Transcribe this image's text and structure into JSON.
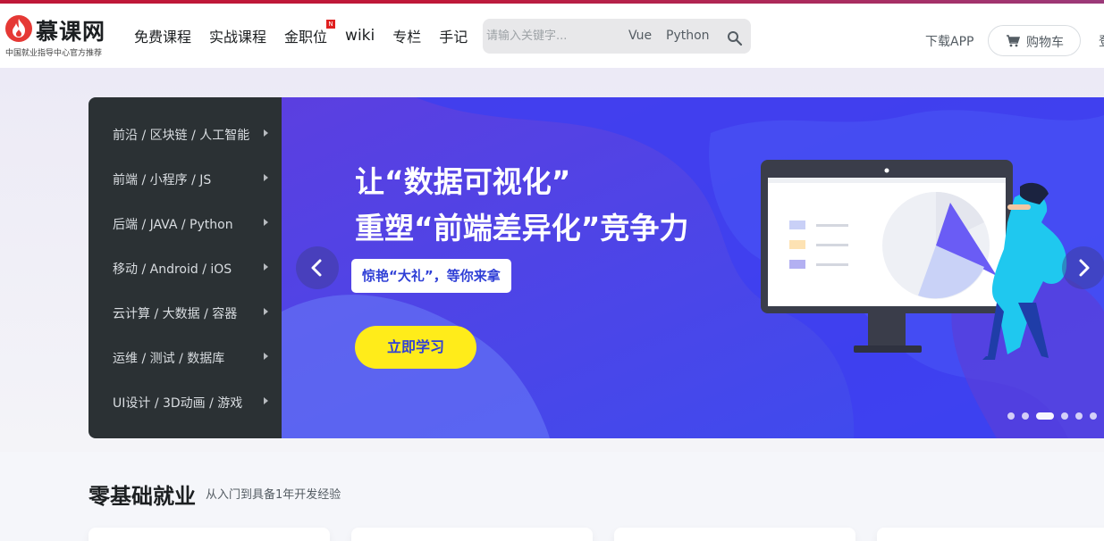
{
  "logo": {
    "name": "慕课网",
    "tagline": "中国就业指导中心官方推荐"
  },
  "nav": {
    "items": [
      {
        "label": "免费课程"
      },
      {
        "label": "实战课程"
      },
      {
        "label": "金职位",
        "badge": "N"
      },
      {
        "label": "wiki"
      },
      {
        "label": "专栏"
      },
      {
        "label": "手记"
      }
    ]
  },
  "search": {
    "placeholder": "请输入关键字...",
    "hot_keywords": [
      "Vue",
      "Python"
    ]
  },
  "header_right": {
    "download_label": "下载APP",
    "cart_label": "购物车",
    "edge_text": "登"
  },
  "category_menu": {
    "items": [
      "前沿 / 区块链 / 人工智能",
      "前端 / 小程序 / JS",
      "后端 / JAVA / Python",
      "移动 / Android / iOS",
      "云计算 / 大数据 / 容器",
      "运维 / 测试 / 数据库",
      "UI设计 / 3D动画 / 游戏"
    ]
  },
  "banner": {
    "headline_1": "让“数据可视化”",
    "headline_2": "重塑“前端差异化”竞争力",
    "gift_text": "惊艳“大礼”，等你来拿",
    "cta_label": "立即学习",
    "slide_count": 6,
    "active_slide": 3
  },
  "section": {
    "title": "零基础就业",
    "subtitle": "从入门到具备1年开发经验"
  },
  "colors": {
    "brand_red": "#e53935",
    "banner_blue": "#4650e8",
    "cta_yellow": "#ffec1a",
    "menu_bg": "#2b3134"
  }
}
